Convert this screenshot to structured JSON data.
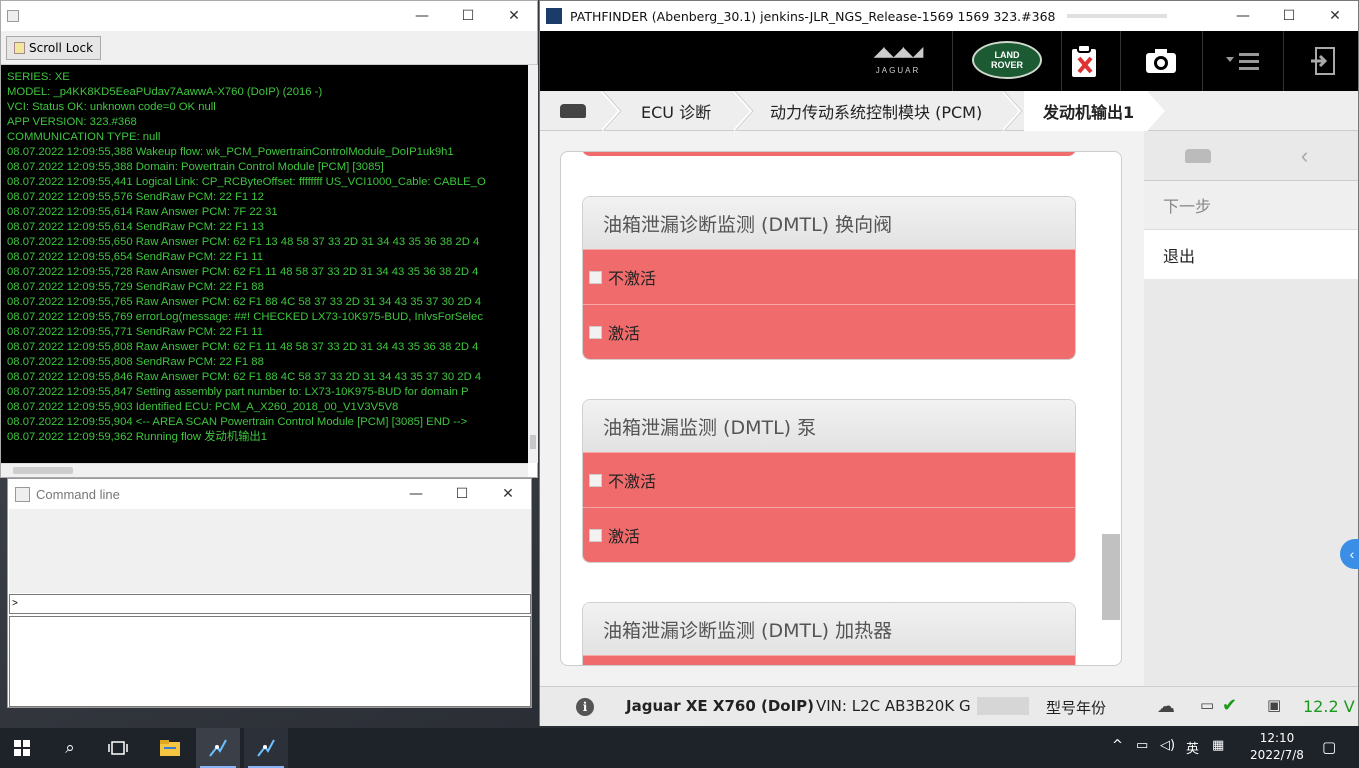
{
  "logger": {
    "scroll_lock_label": "Scroll Lock",
    "lines": [
      "SERIES: XE",
      "MODEL: _p4KK8KD5EeaPUdav7AawwA-X760 (DoIP) (2016 -)",
      "VCI: Status OK: unknown code=0 OK null",
      "APP VERSION: 323.#368",
      "COMMUNICATION TYPE: null",
      "08.07.2022 12:09:55,388 Wakeup flow: wk_PCM_PowertrainControlModule_DoIP1uk9h1",
      "08.07.2022 12:09:55,388 Domain: Powertrain Control Module [PCM] [3085]",
      "08.07.2022 12:09:55,441 Logical Link: CP_RCByteOffset: ffffffff US_VCI1000_Cable: CABLE_O",
      "08.07.2022 12:09:55,576 SendRaw PCM: 22 F1 12",
      "08.07.2022 12:09:55,614 Raw Answer PCM: 7F 22 31",
      "08.07.2022 12:09:55,614 SendRaw PCM: 22 F1 13",
      "08.07.2022 12:09:55,650 Raw Answer PCM: 62 F1 13 48 58 37 33 2D 31 34 43 35 36 38 2D 4",
      "08.07.2022 12:09:55,654 SendRaw PCM: 22 F1 11",
      "08.07.2022 12:09:55,728 Raw Answer PCM: 62 F1 11 48 58 37 33 2D 31 34 43 35 36 38 2D 4",
      "08.07.2022 12:09:55,729 SendRaw PCM: 22 F1 88",
      "08.07.2022 12:09:55,765 Raw Answer PCM: 62 F1 88 4C 58 37 33 2D 31 34 43 35 37 30 2D 4",
      "08.07.2022 12:09:55,769 errorLog(message: ##! CHECKED LX73-10K975-BUD, InlvsForSelec",
      "08.07.2022 12:09:55,771 SendRaw PCM: 22 F1 11",
      "08.07.2022 12:09:55,808 Raw Answer PCM: 62 F1 11 48 58 37 33 2D 31 34 43 35 36 38 2D 4",
      "08.07.2022 12:09:55,808 SendRaw PCM: 22 F1 88",
      "08.07.2022 12:09:55,846 Raw Answer PCM: 62 F1 88 4C 58 37 33 2D 31 34 43 35 37 30 2D 4",
      "08.07.2022 12:09:55,847 Setting assembly part number to: LX73-10K975-BUD for domain P",
      "08.07.2022 12:09:55,903 Identified ECU: PCM_A_X260_2018_00_V1V3V5V8",
      "08.07.2022 12:09:55,904 <-- AREA SCAN Powertrain Control Module [PCM] [3085] END -->",
      "08.07.2022 12:09:59,362 Running flow 发动机输出1"
    ]
  },
  "cmd": {
    "title": "Command line",
    "prompt": ">"
  },
  "pathfinder": {
    "title": "PATHFINDER (Abenberg_30.1) jenkins-JLR_NGS_Release-1569 1569 323.#368",
    "brand_jaguar": "JAGUAR",
    "brand_lr_line1": "LAND",
    "brand_lr_line2": "ROVER",
    "breadcrumb": [
      "ECU 诊断",
      "动力传动系统控制模块 (PCM)",
      "发动机输出1"
    ],
    "groups": [
      {
        "title": "油箱泄漏诊断监测 (DMTL) 换向阀",
        "options": [
          "不激活",
          "激活"
        ]
      },
      {
        "title": "油箱泄漏监测 (DMTL) 泵",
        "options": [
          "不激活",
          "激活"
        ]
      },
      {
        "title": "油箱泄漏诊断监测 (DMTL) 加热器",
        "options": []
      }
    ],
    "side_next": "下一步",
    "side_exit": "退出",
    "status_vehicle": "Jaguar XE X760 (DoIP)",
    "status_vin": "VIN: L2C AB3B20K G",
    "status_model_year": "型号年份",
    "status_voltage": "12.2 V"
  },
  "taskbar": {
    "ime": "英",
    "time": "12:10",
    "date": "2022/7/8"
  }
}
